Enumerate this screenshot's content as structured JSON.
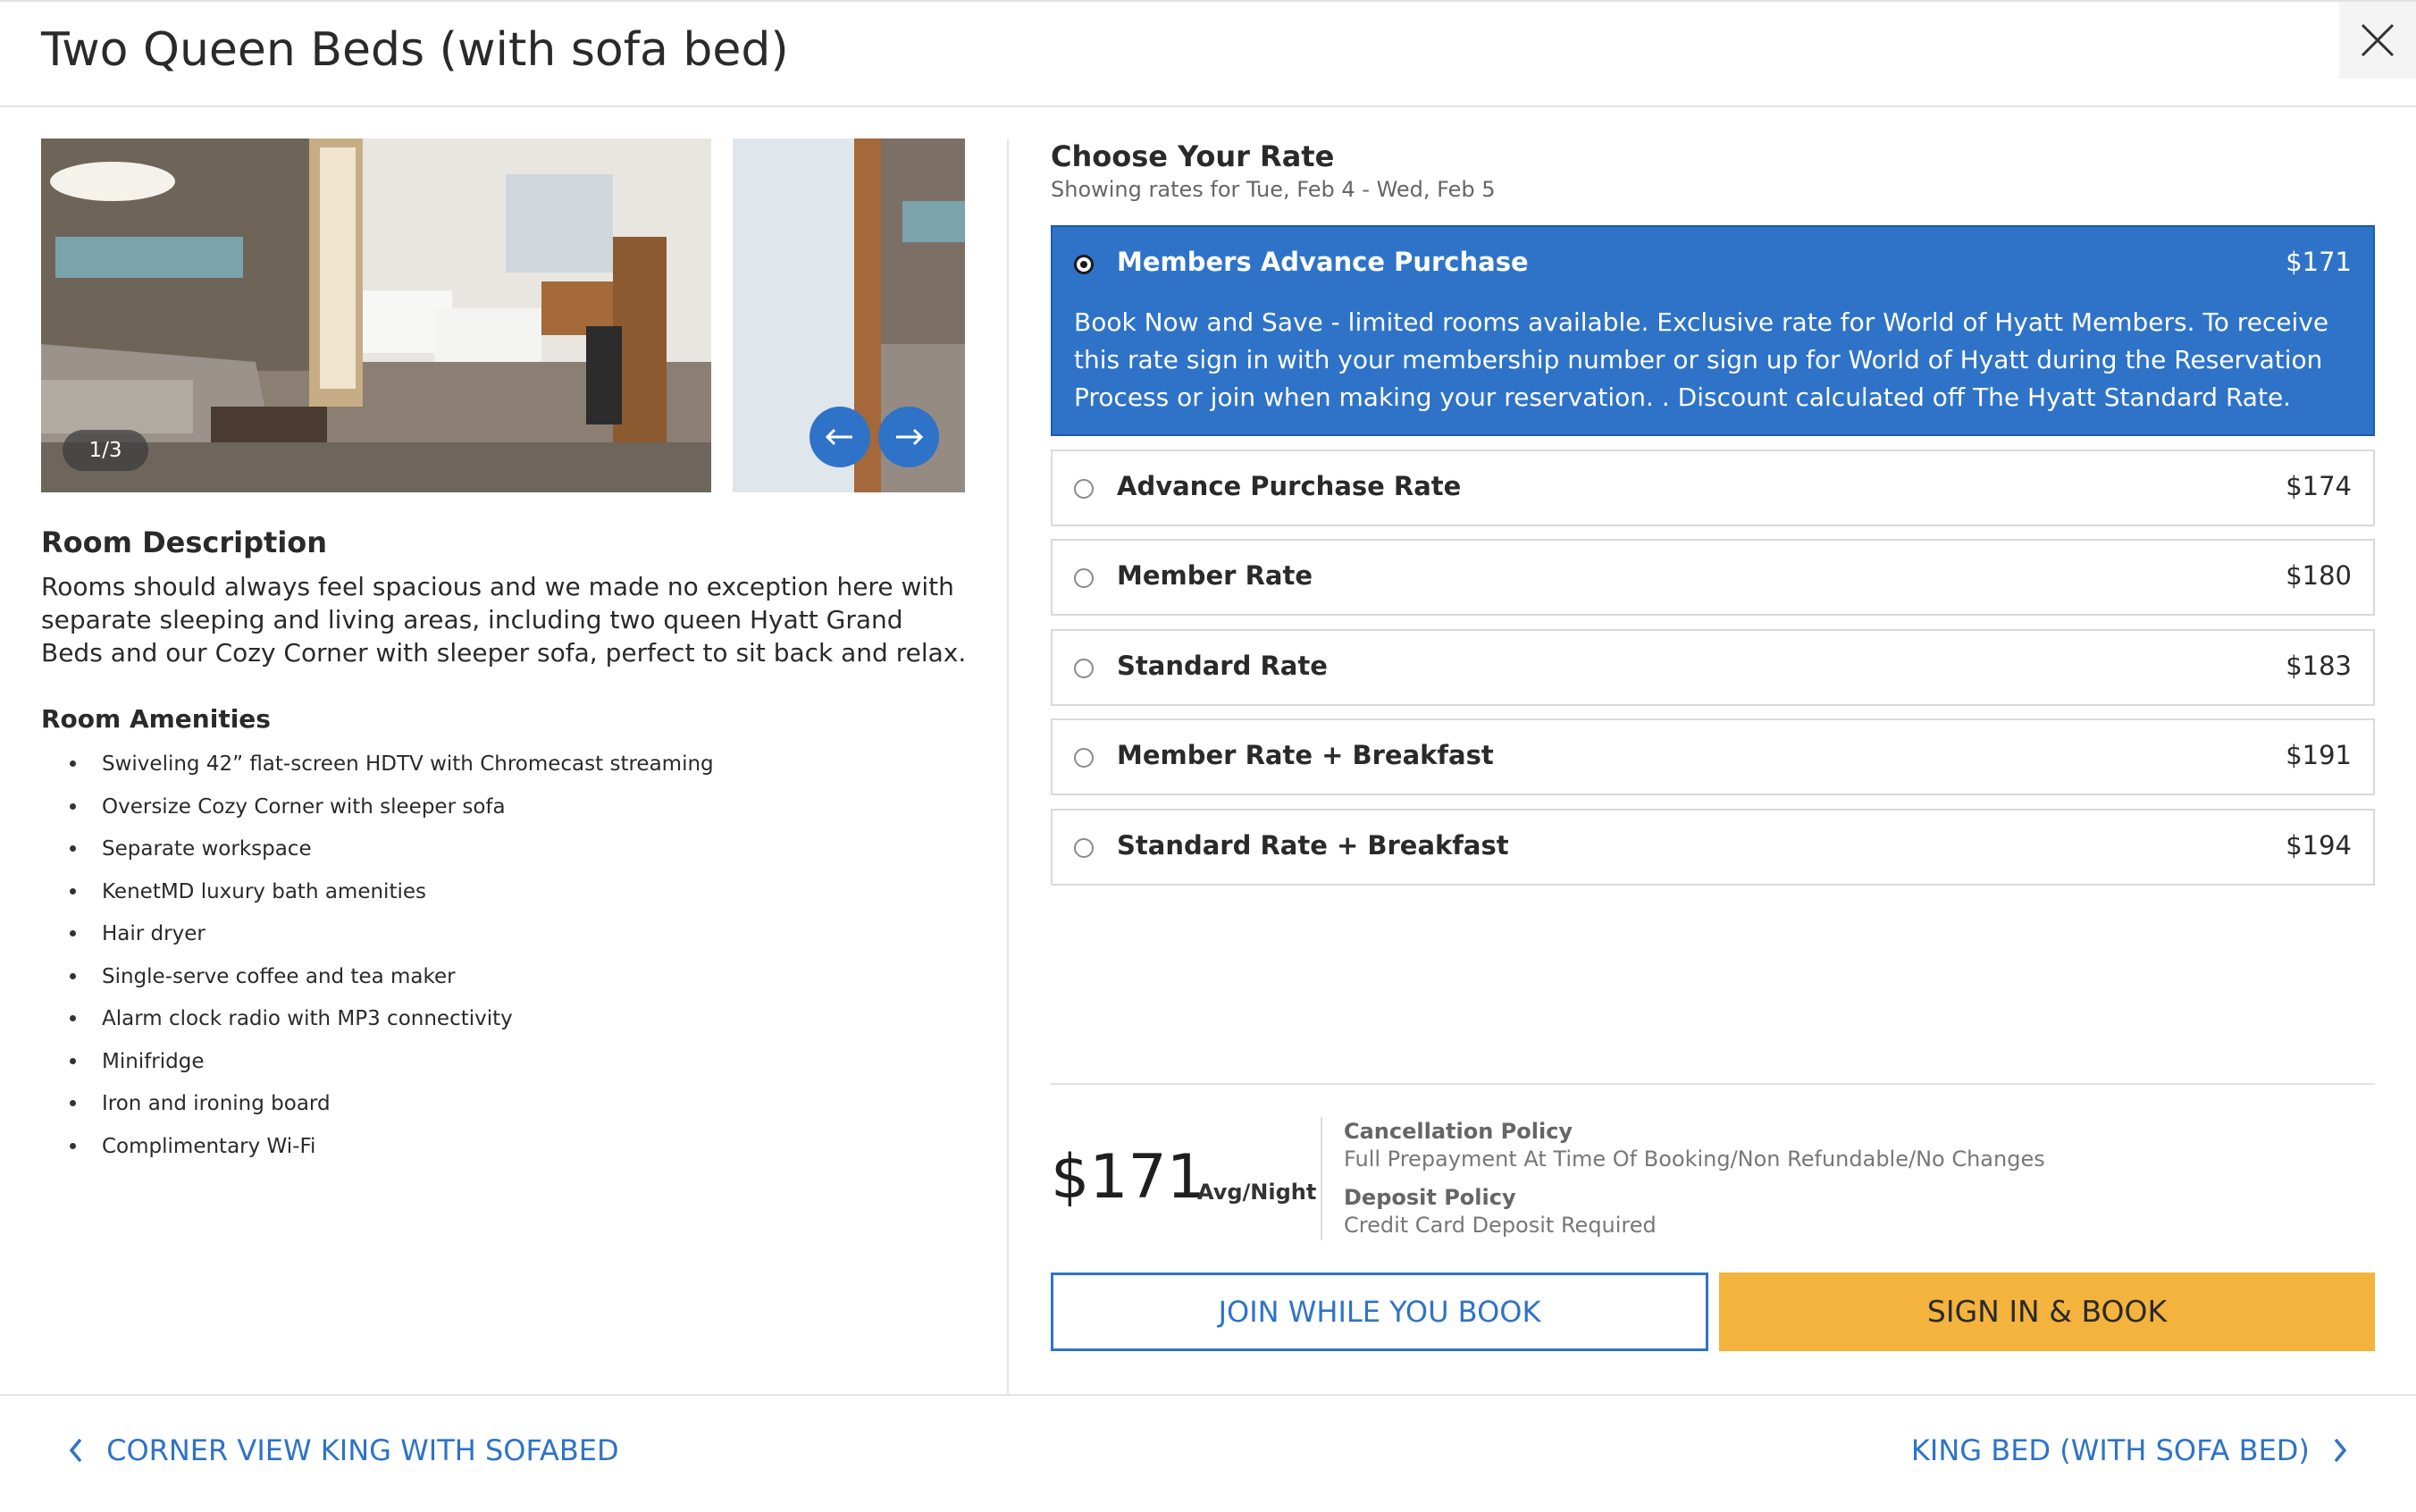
{
  "header": {
    "title": "Two Queen Beds (with sofa bed)"
  },
  "gallery": {
    "counter": "1/3"
  },
  "room": {
    "description_heading": "Room Description",
    "description": "Rooms should always feel spacious and we made no exception here with separate sleeping and living areas, including two queen Hyatt Grand Beds and our Cozy Corner with sleeper sofa, perfect to sit back and relax.",
    "amenities_heading": "Room Amenities",
    "amenities": [
      "Swiveling 42” flat-screen HDTV with Chromecast streaming",
      "Oversize Cozy Corner with sleeper sofa",
      "Separate workspace",
      "KenetMD luxury bath amenities",
      "Hair dryer",
      "Single-serve coffee and tea maker",
      "Alarm clock radio with MP3 connectivity",
      "Minifridge",
      "Iron and ironing board",
      "Complimentary Wi-Fi"
    ]
  },
  "rates": {
    "heading": "Choose Your Rate",
    "subheading": "Showing rates for Tue, Feb 4 - Wed, Feb 5",
    "options": [
      {
        "name": "Members Advance Purchase",
        "price": "$171",
        "selected": true,
        "description": "Book Now and Save - limited rooms available. Exclusive rate for World of Hyatt Members. To receive this rate sign in with your membership number or sign up for World of Hyatt during the Reservation Process or join when making your reservation. . Discount calculated off The Hyatt Standard Rate."
      },
      {
        "name": "Advance Purchase Rate",
        "price": "$174",
        "selected": false
      },
      {
        "name": "Member Rate",
        "price": "$180",
        "selected": false
      },
      {
        "name": "Standard Rate",
        "price": "$183",
        "selected": false
      },
      {
        "name": "Member Rate + Breakfast",
        "price": "$191",
        "selected": false
      },
      {
        "name": "Standard Rate + Breakfast",
        "price": "$194",
        "selected": false
      }
    ]
  },
  "summary": {
    "price": "$171",
    "per_night": "Avg/Night",
    "cancellation_label": "Cancellation Policy",
    "cancellation_value": "Full Prepayment At Time Of Booking/Non Refundable/No Changes",
    "deposit_label": "Deposit Policy",
    "deposit_value": "Credit Card Deposit Required"
  },
  "actions": {
    "join_label": "JOIN WHILE YOU BOOK",
    "sign_in_label": "SIGN IN & BOOK"
  },
  "footer": {
    "prev_room": "CORNER VIEW KING WITH SOFABED",
    "next_room": "KING BED (WITH SOFA BED)"
  },
  "icons": {
    "close": "close-icon",
    "prev_photo": "arrow-left-icon",
    "next_photo": "arrow-right-icon",
    "prev_room": "chevron-left-icon",
    "next_room": "chevron-right-icon"
  },
  "colors": {
    "accent": "#2e73c8",
    "cta": "#f3b33d",
    "selected_rate_bg": "#2e73c8"
  }
}
